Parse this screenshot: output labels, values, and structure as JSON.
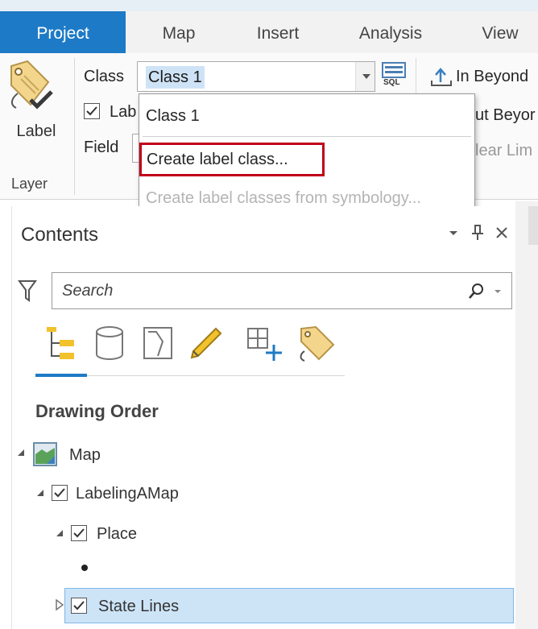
{
  "ribbon": {
    "tabs": [
      "Project",
      "Map",
      "Insert",
      "Analysis",
      "View"
    ],
    "active_tab": "Project",
    "label_button": "Label",
    "group_label": "Layer",
    "class_label": "Class",
    "class_value": "Class 1",
    "label_checkbox_text": "Lab",
    "field_label": "Field",
    "sql_text": "SQL",
    "in_beyond": "In Beyond",
    "out_beyond": "ut Beyor",
    "clear_limits": "lear Lim"
  },
  "dropdown": {
    "items": [
      "Class 1",
      "Create label class...",
      "Create label classes from symbology..."
    ],
    "highlighted_index": 1
  },
  "contents": {
    "title": "Contents",
    "search_placeholder": "Search",
    "section_heading": "Drawing Order",
    "tree": [
      {
        "label": "Map",
        "level": 0,
        "checked": false,
        "expanded": true
      },
      {
        "label": "LabelingAMap",
        "level": 1,
        "checked": true,
        "expanded": true
      },
      {
        "label": "Place",
        "level": 2,
        "checked": true,
        "expanded": true
      },
      {
        "label": "State Lines",
        "level": 2,
        "checked": true,
        "expanded": false,
        "selected": true
      }
    ]
  },
  "colors": {
    "accent": "#1d7ac6",
    "highlight_border": "#c0001a",
    "selection_fill": "#cde4f7"
  }
}
